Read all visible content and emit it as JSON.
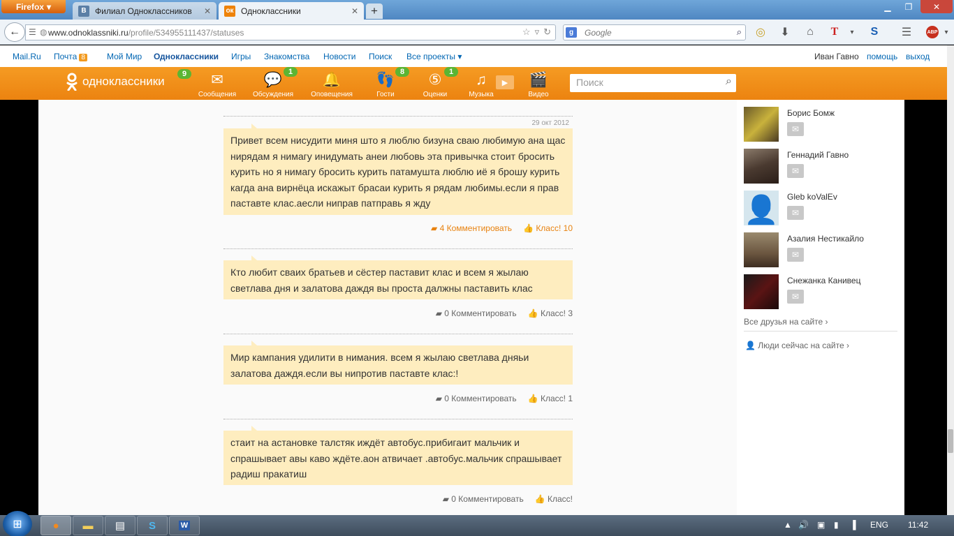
{
  "browser": {
    "app_button": "Firefox",
    "tabs": [
      {
        "label": "Филиал Одноклассников",
        "icon": "vk-icon",
        "icon_text": "В",
        "icon_color": "#5b7fa6"
      },
      {
        "label": "Одноклассники",
        "icon": "ok-icon",
        "icon_text": "ок",
        "icon_color": "#ee8208"
      }
    ],
    "url_domain": "www.odnoklassniki.ru",
    "url_path": "/profile/534955111437/statuses",
    "search_engine_badge": "g",
    "search_placeholder": "Google"
  },
  "linkbar": {
    "left": [
      "Mail.Ru",
      "Почта",
      "Мой Мир",
      "Одноклассники",
      "Игры",
      "Знакомства",
      "Новости",
      "Поиск",
      "Все проекты ▾"
    ],
    "mail_count": "8",
    "user_name": "Иван Гавно",
    "help": "помощь",
    "logout": "выход"
  },
  "ok_nav": {
    "logo_text": "одноклассники",
    "logo_badge": "9",
    "items": [
      {
        "label": "Сообщения",
        "icon": "envelope-icon",
        "badge": ""
      },
      {
        "label": "Обсуждения",
        "icon": "speech-bubbles-icon",
        "badge": "1"
      },
      {
        "label": "Оповещения",
        "icon": "bell-icon",
        "badge": ""
      },
      {
        "label": "Гости",
        "icon": "footprints-icon",
        "badge": "8"
      },
      {
        "label": "Оценки",
        "icon": "rating-five-icon",
        "badge": "1"
      },
      {
        "label": "Музыка",
        "icon": "music-note-icon",
        "badge": ""
      },
      {
        "label": "Видео",
        "icon": "clapper-icon",
        "badge": ""
      }
    ],
    "search_placeholder": "Поиск"
  },
  "posts": [
    {
      "date": "29 окт 2012",
      "text": "Привет всем нисудити миня што я люблю бизуна сваю любимую ана щас нирядам я нимагу инидумать анеи любовь эта привычка стоит бросить курить но я нимагу бросить курить патамушта люблю иё я брошу курить кагда ана вирнёца искажыт брасаи курить я рядам любимы.если я прав паставте клас.аесли ниправ патправь я жду",
      "comments": "4 Комментировать",
      "likes": "Класс! 10"
    },
    {
      "date": "",
      "text": "Кто любит сваих братьев и сёстер паставит клас и всем я жылаю светлава дня и залатова даждя вы проста далжны паставить клас",
      "comments": "0 Комментировать",
      "likes": "Класс! 3"
    },
    {
      "date": "",
      "text": "Мир кампания удилити в нимания. всем я жылаю светлава дняьи залатова даждя.если вы нипротив паставте клас:!",
      "comments": "0 Комментировать",
      "likes": "Класс! 1"
    },
    {
      "date": "",
      "text": "стаит на астановке талстяк иждёт автобус.прибигаит мальчик и спрашывает авы каво ждёте.аон атвичает .автобус.мальчик спрашывает радиш пракатиш",
      "comments": "0 Комментировать",
      "likes": "Класс!"
    }
  ],
  "friends": [
    {
      "name": "Борис Бомж",
      "avatar_color": "#b9a23a"
    },
    {
      "name": "Геннадий Гавно",
      "avatar_color": "#5c4a3e"
    },
    {
      "name": "Gleb koValEv",
      "avatar_color": "#d5e6ee"
    },
    {
      "name": "Азалия Нестикайло",
      "avatar_color": "#7c6850"
    },
    {
      "name": "Снежанка Канивец",
      "avatar_color": "#2a1a1a"
    }
  ],
  "sidebar_links": {
    "all_friends": "Все друзья на сайте ›",
    "people_online": "Люди сейчас на сайте ›"
  },
  "taskbar": {
    "language": "ENG",
    "time": "11:42"
  }
}
